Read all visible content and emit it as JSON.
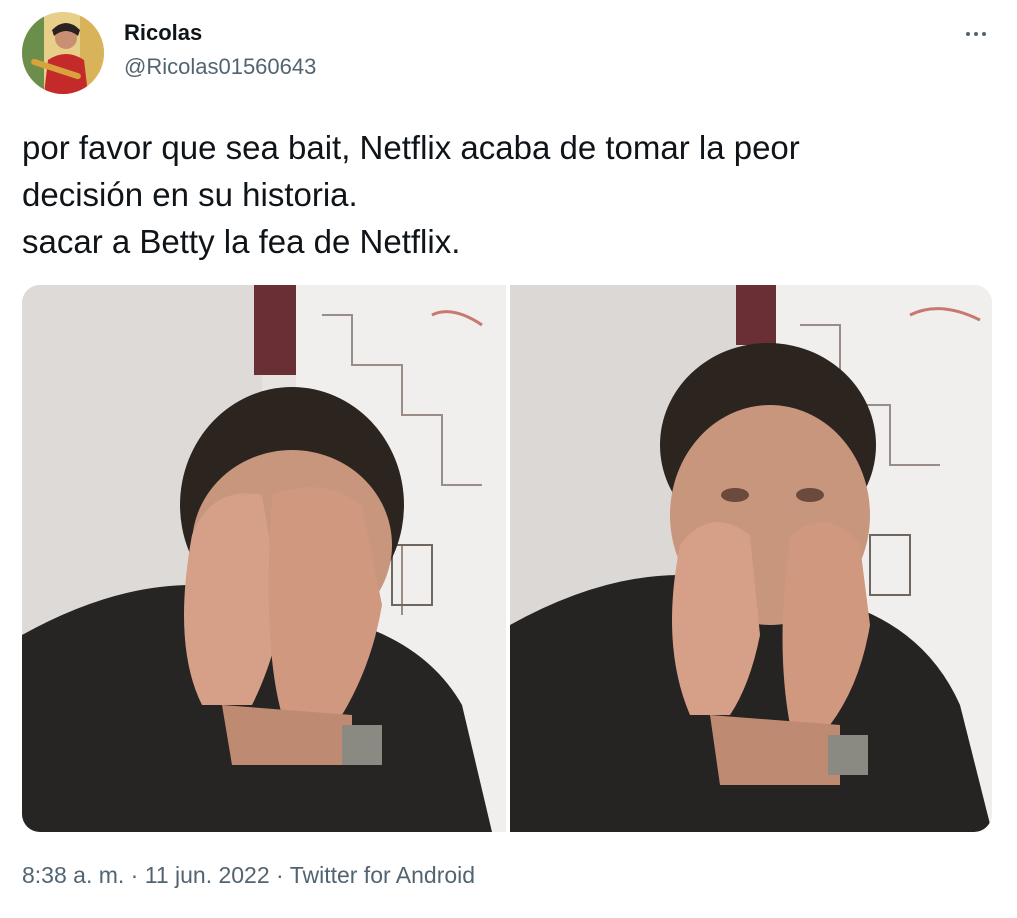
{
  "author": {
    "display_name": "Ricolas",
    "handle": "@Ricolas01560643"
  },
  "tweet": {
    "text_lines": [
      "por favor que sea bait, Netflix acaba de tomar la peor",
      "decisión en su historia.",
      "sacar a Betty la fea de Netflix."
    ]
  },
  "meta": {
    "time": "8:38 a. m.",
    "separator": "·",
    "date": "11 jun. 2022",
    "source": "Twitter for Android"
  },
  "icons": {
    "more": "more-horizontal-icon"
  },
  "colors": {
    "text_primary": "#0f1419",
    "text_secondary": "#536471",
    "background": "#ffffff"
  }
}
